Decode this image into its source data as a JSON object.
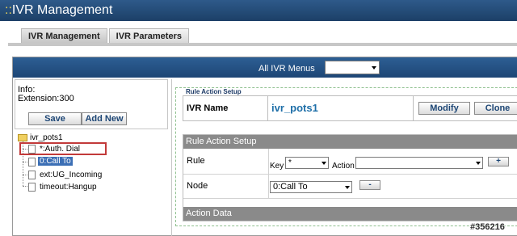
{
  "window": {
    "title_prefix": "::",
    "title": "IVR Management"
  },
  "tabs": [
    {
      "label": "IVR Management",
      "active": true
    },
    {
      "label": "IVR Parameters",
      "active": false
    }
  ],
  "menubar": {
    "label": "All IVR Menus",
    "select_value": ""
  },
  "info": {
    "label": "Info:",
    "extension": "Extension:300"
  },
  "buttons": {
    "save": "Save",
    "add_new": "Add New",
    "modify": "Modify",
    "clone": "Clone"
  },
  "tree": {
    "root": "ivr_pots1",
    "children": [
      "*:Auth. Dial",
      "0:Call To",
      "ext:UG_Incoming",
      "timeout:Hangup"
    ],
    "selected_index": 1
  },
  "rule_action_setup": {
    "legend": "Rule Action Setup",
    "ivr_name_label": "IVR Name",
    "ivr_name_value": "ivr_pots1",
    "section_header": "Rule Action Setup",
    "rule_label": "Rule",
    "key_label": "Key",
    "key_value": "*",
    "action_label": "Action",
    "action_value": "",
    "add_button": "+",
    "node_label": "Node",
    "node_value": "0:Call To",
    "remove_button": "-",
    "action_data_header": "Action Data"
  },
  "watermark": "#356216",
  "colors": {
    "titlebar": "#1c3f67",
    "accent_text": "#1d4675",
    "highlight_border": "#c23a3a",
    "selected_node": "#3c6fb5"
  }
}
